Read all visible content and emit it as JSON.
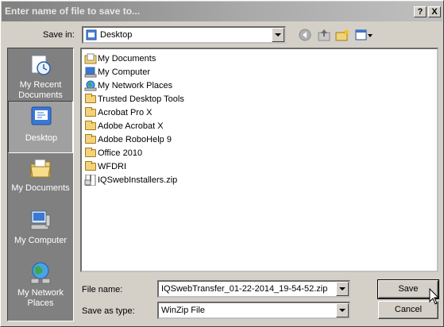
{
  "window": {
    "title": "Enter name of file to save to...",
    "help_btn": "?",
    "close_btn": "X"
  },
  "toolbar": {
    "save_in_label": "Save in:",
    "save_in_value": "Desktop",
    "icons": [
      "back-icon",
      "up-folder-icon",
      "new-folder-icon",
      "view-menu-icon"
    ]
  },
  "places": [
    {
      "label": "My Recent Documents",
      "icon": "recent-documents-icon"
    },
    {
      "label": "Desktop",
      "icon": "desktop-icon",
      "selected": true
    },
    {
      "label": "My Documents",
      "icon": "my-documents-icon"
    },
    {
      "label": "My Computer",
      "icon": "my-computer-icon"
    },
    {
      "label": "My Network Places",
      "icon": "network-places-icon"
    }
  ],
  "files": [
    {
      "name": "My Documents",
      "icon": "documents-folder-icon"
    },
    {
      "name": "My Computer",
      "icon": "computer-icon"
    },
    {
      "name": "My Network Places",
      "icon": "network-icon"
    },
    {
      "name": "Trusted Desktop Tools",
      "icon": "folder-icon"
    },
    {
      "name": "Acrobat Pro X",
      "icon": "folder-icon"
    },
    {
      "name": "Adobe Acrobat X",
      "icon": "folder-icon"
    },
    {
      "name": "Adobe RoboHelp 9",
      "icon": "folder-icon"
    },
    {
      "name": "Office 2010",
      "icon": "folder-icon"
    },
    {
      "name": "WFDRI",
      "icon": "folder-icon"
    },
    {
      "name": "IQSwebInstallers.zip",
      "icon": "zip-file-icon"
    }
  ],
  "bottom": {
    "file_name_label": "File name:",
    "file_name_value": "IQSwebTransfer_01-22-2014_19-54-52.zip",
    "save_type_label": "Save as type:",
    "save_type_value": "WinZip File",
    "save_btn": "Save",
    "cancel_btn": "Cancel"
  }
}
